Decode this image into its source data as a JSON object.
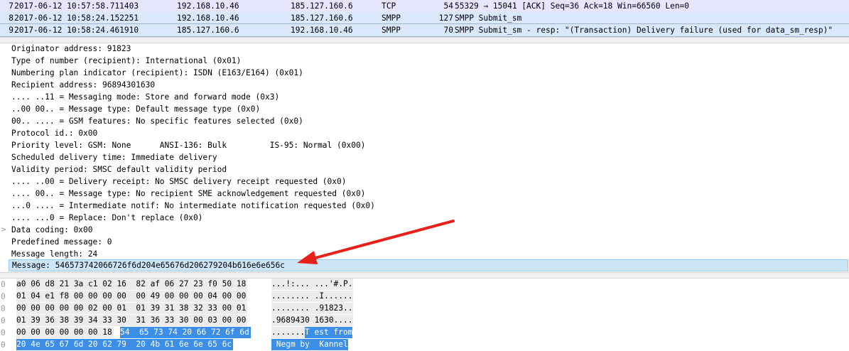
{
  "packets": [
    {
      "no": "7",
      "time": "2017-06-12 10:57:58.711403",
      "src": "192.168.10.46",
      "dst": "185.127.160.6",
      "proto": "TCP",
      "len": "54",
      "info": "55329 → 15041 [ACK] Seq=36 Ack=18 Win=66560 Len=0"
    },
    {
      "no": "8",
      "time": "2017-06-12 10:58:24.152251",
      "src": "192.168.10.46",
      "dst": "185.127.160.6",
      "proto": "SMPP",
      "len": "127",
      "info": "SMPP Submit_sm"
    },
    {
      "no": "9",
      "time": "2017-06-12 10:58:24.461910",
      "src": "185.127.160.6",
      "dst": "192.168.10.46",
      "proto": "SMPP",
      "len": "70",
      "info": "SMPP Submit_sm - resp: \"(Transaction) Delivery failure (used for data_sm_resp)\""
    }
  ],
  "details": [
    "Originator address: 91823",
    "Type of number (recipient): International (0x01)",
    "Numbering plan indicator (recipient): ISDN (E163/E164) (0x01)",
    "Recipient address: 96894301630",
    ".... ..11 = Messaging mode: Store and forward mode (0x3)",
    "..00 00.. = Message type: Default message type (0x0)",
    "00.. .... = GSM features: No specific features selected (0x0)",
    "Protocol id.: 0x00",
    "Priority level: GSM: None      ANSI-136: Bulk         IS-95: Normal (0x00)",
    "Scheduled delivery time: Immediate delivery",
    "Validity period: SMSC default validity period",
    ".... ..00 = Delivery receipt: No SMSC delivery receipt requested (0x0)",
    ".... 00.. = Message type: No recipient SME acknowledgement requested (0x0)",
    "...0 .... = Intermediate notif: No intermediate notification requested (0x0)",
    ".... ...0 = Replace: Don't replace (0x0)",
    "Data coding: 0x00",
    "Predefined message: 0",
    "Message length: 24",
    "Message: 546573742066726f6d204e65676d206279204b616e6e656c"
  ],
  "expander_glyph": ">",
  "bytes": [
    {
      "off": "0",
      "hex": "a0 06 d8 21 3a c1 02 16  82 af 06 27 23 f0 50 18",
      "hexsel": "",
      "ascii": "...!:... ...'#.P.",
      "asciisel": ""
    },
    {
      "off": "0",
      "hex": "01 04 e1 f8 00 00 00 00  00 49 00 00 00 04 00 00",
      "hexsel": "",
      "ascii": "........ .I......",
      "asciisel": ""
    },
    {
      "off": "0",
      "hex": "00 00 00 00 00 02 00 01  01 39 31 38 32 33 00 01",
      "hexsel": "",
      "ascii": "........ .91823..",
      "asciisel": ""
    },
    {
      "off": "0",
      "hex": "01 39 36 38 39 34 33 30  31 36 33 30 00 03 00 00",
      "hexsel": "",
      "ascii": ".9689430 1630....",
      "asciisel": ""
    },
    {
      "off": "0",
      "hex": "00 00 00 00 00 00 18",
      "hexsel": "54  65 73 74 20 66 72 6f 6d",
      "ascii": ".......",
      "asciisel": "T est from"
    },
    {
      "off": "0",
      "hex": "",
      "hexsel": "20 4e 65 67 6d 20 62 79  20 4b 61 6e 6e 65 6c",
      "ascii": "",
      "asciisel": " Negm by  Kannel"
    }
  ],
  "colors": {
    "tcp_row": "#e7e6ff",
    "smpp_row": "#dae8fc",
    "highlight": "#cce5f7",
    "byte_select": "#3d8ee6",
    "arrow": "#e8201a"
  },
  "annotation": {
    "type": "arrow",
    "color": "#e8201a",
    "target": "Message field"
  }
}
